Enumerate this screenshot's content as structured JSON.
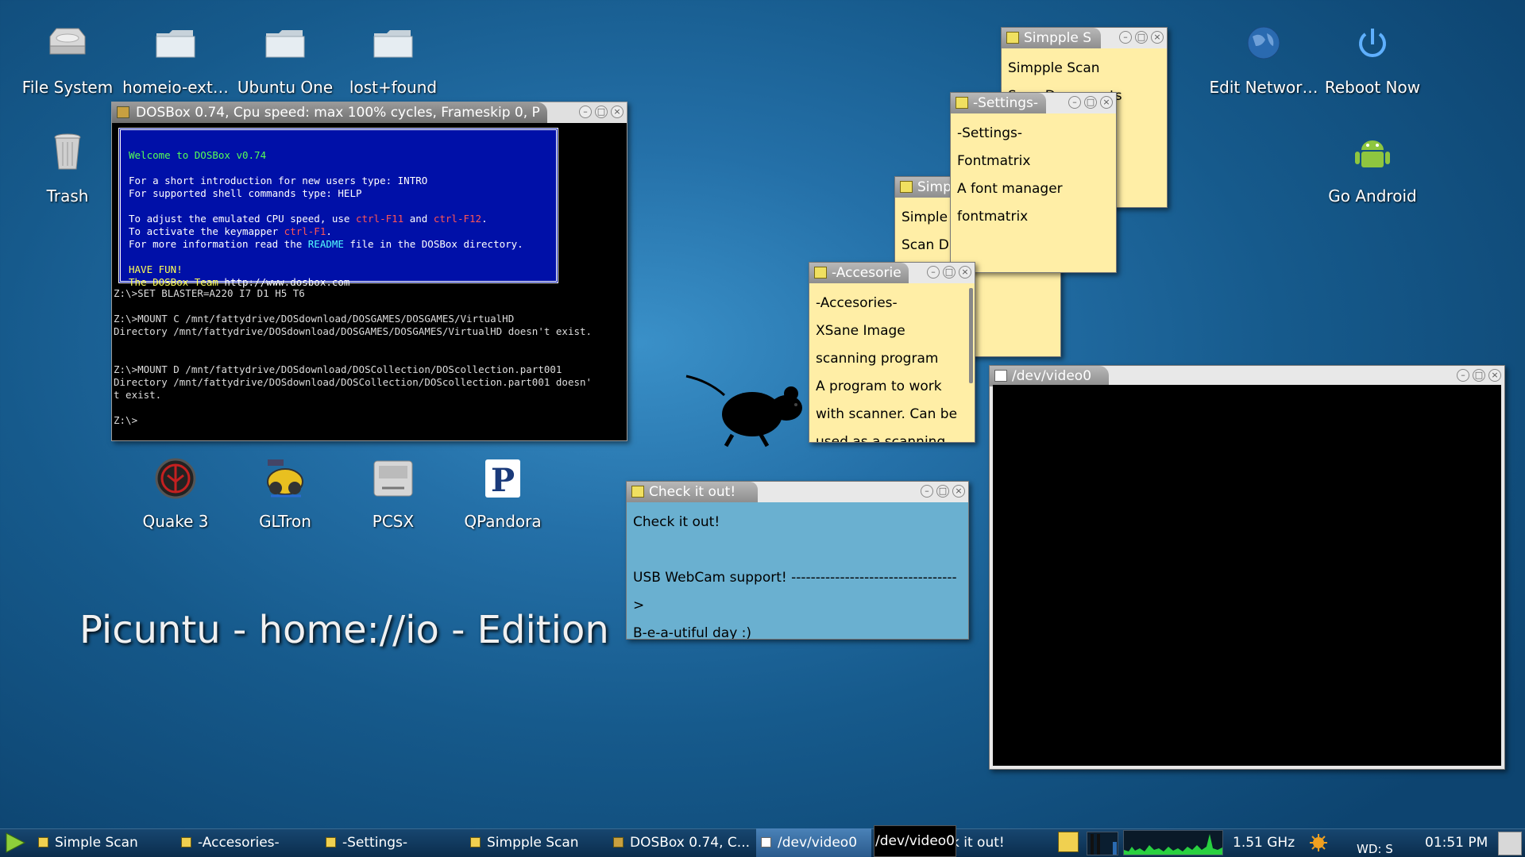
{
  "desktop": {
    "icons": [
      {
        "label": "File System",
        "icon": "drive-icon"
      },
      {
        "label": "homeio-ext…",
        "icon": "folder-icon"
      },
      {
        "label": "Ubuntu One",
        "icon": "folder-icon"
      },
      {
        "label": "lost+found",
        "icon": "folder-icon"
      },
      {
        "label": "Trash",
        "icon": "trash-icon"
      },
      {
        "label": "Quake 3",
        "icon": "quake-icon"
      },
      {
        "label": "GLTron",
        "icon": "gltron-icon"
      },
      {
        "label": "PCSX",
        "icon": "pcsx-icon"
      },
      {
        "label": "QPandora",
        "icon": "pandora-icon"
      },
      {
        "label": "Edit Networ…",
        "icon": "network-globe-icon"
      },
      {
        "label": "Reboot Now",
        "icon": "power-icon"
      },
      {
        "label": "Go Android",
        "icon": "android-icon"
      }
    ],
    "banner": "Picuntu - home://io - Edition"
  },
  "dosbox": {
    "title": "DOSBox 0.74, Cpu speed:  max 100% cycles, Frameskip  0, P",
    "welcome": {
      "l1": "Welcome to DOSBox v0.74",
      "l2": "For a short introduction for new users type: INTRO",
      "l3": "For supported shell commands type: HELP",
      "l4a": "To adjust the emulated CPU speed, use ",
      "l4b": "ctrl-F11",
      "l4c": " and ",
      "l4d": "ctrl-F12",
      "l4e": ".",
      "l5a": "To activate the keymapper ",
      "l5b": "ctrl-F1",
      "l5c": ".",
      "l6a": "For more information read the ",
      "l6b": "README",
      "l6c": " file in the DOSBox directory.",
      "l7": "HAVE FUN!",
      "l8a": "The DOSBox Team ",
      "l8b": "http://www.dosbox.com"
    },
    "output": "Z:\\>SET BLASTER=A220 I7 D1 H5 T6\n\nZ:\\>MOUNT C /mnt/fattydrive/DOSdownload/DOSGAMES/DOSGAMES/VirtualHD\nDirectory /mnt/fattydrive/DOSdownload/DOSGAMES/DOSGAMES/VirtualHD doesn't exist.\n\n\nZ:\\>MOUNT D /mnt/fattydrive/DOSdownload/DOSCollection/DOScollection.part001\nDirectory /mnt/fattydrive/DOSdownload/DOSCollection/DOScollection.part001 doesn'\nt exist.\n\nZ:\\>"
  },
  "notes": {
    "simpple": {
      "title": "Simpple S",
      "lines": [
        "Simpple Scan",
        "Scan Documents"
      ]
    },
    "settings": {
      "title": "-Settings-",
      "lines": [
        "-Settings-",
        "Fontmatrix",
        "A font manager",
        "fontmatrix"
      ]
    },
    "simp": {
      "title": "Simp",
      "lines": [
        "Simple",
        "Scan D"
      ]
    },
    "accesorie": {
      "title": "-Accesorie",
      "lines": [
        "-Accesories-",
        "XSane Image",
        "scanning program",
        "A program to work",
        "with scanner. Can be",
        "used as a scanning"
      ]
    },
    "check": {
      "title": "Check  it  out!",
      "lines": [
        "Check it out!",
        "",
        "USB WebCam support! ---------------------------------->",
        "B-e-a-utiful day :)"
      ]
    }
  },
  "video": {
    "title": "/dev/video0"
  },
  "taskbar": {
    "items": [
      "Simple Scan",
      "-Accesories-",
      "-Settings-",
      "Simpple Scan",
      "DOSBox 0.74, C...",
      "/dev/video0",
      "k it out!"
    ],
    "tooltip": "/dev/video0",
    "cpu_freq": "1.51 GHz",
    "weather": "WD: S",
    "clock": "01:51 PM"
  },
  "colors": {
    "dos_blue": "#0010a8",
    "dos_cyan": "#55ffff",
    "dos_red": "#ff5555",
    "note_yellow": "#ffeea6",
    "note_blue": "#6ab0d0",
    "taskbar": "#0e3352",
    "graph_green": "#28d040"
  }
}
